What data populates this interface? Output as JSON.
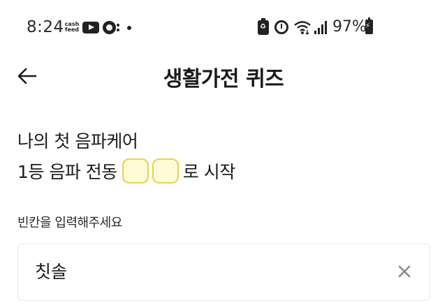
{
  "status_bar": {
    "time": "8:24",
    "cash_icon_text": "cash feed",
    "battery_percent": "97%",
    "left_icons": [
      "cashfeed-icon",
      "youtube-icon",
      "o-icon",
      "colon-icon",
      "dot-icon"
    ],
    "right_icons": [
      "recycle-icon",
      "alarm-icon",
      "wifi-icon",
      "signal-icon",
      "battery-charging-icon"
    ]
  },
  "header": {
    "title": "생활가전 퀴즈",
    "back_icon": "arrow-left-icon"
  },
  "quiz": {
    "line1": "나의 첫 음파케어",
    "line2_prefix": "1등 음파 전동",
    "blank_count": 2,
    "line2_suffix": "로 시작",
    "instruction": "빈칸을 입력해주세요"
  },
  "answer": {
    "value": "칫솔",
    "clear_icon": "close-icon"
  },
  "colors": {
    "blank_fill": "#fffbd6",
    "blank_border": "#e3d54a",
    "text": "#1b1b1b",
    "clear_icon": "#8a8a8a"
  }
}
